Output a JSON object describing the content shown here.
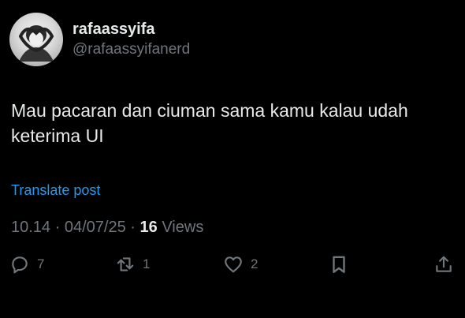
{
  "author": {
    "display_name": "rafaassyifa",
    "handle": "@rafaassyifanerd"
  },
  "tweet": {
    "text": "Mau pacaran dan ciuman sama kamu kalau udah keterima UI",
    "translate_label": "Translate post"
  },
  "meta": {
    "time": "10.14",
    "separator": "·",
    "date": "04/07/25",
    "views_count": "16",
    "views_label": "Views"
  },
  "actions": {
    "reply_count": "7",
    "repost_count": "1",
    "like_count": "2",
    "reply_icon": "reply-icon",
    "repost_icon": "repost-icon",
    "like_icon": "heart-icon",
    "bookmark_icon": "bookmark-icon",
    "share_icon": "share-icon"
  },
  "colors": {
    "background": "#000000",
    "text_primary": "#e7e9ea",
    "text_secondary": "#71767b",
    "link": "#1d9bf0"
  }
}
